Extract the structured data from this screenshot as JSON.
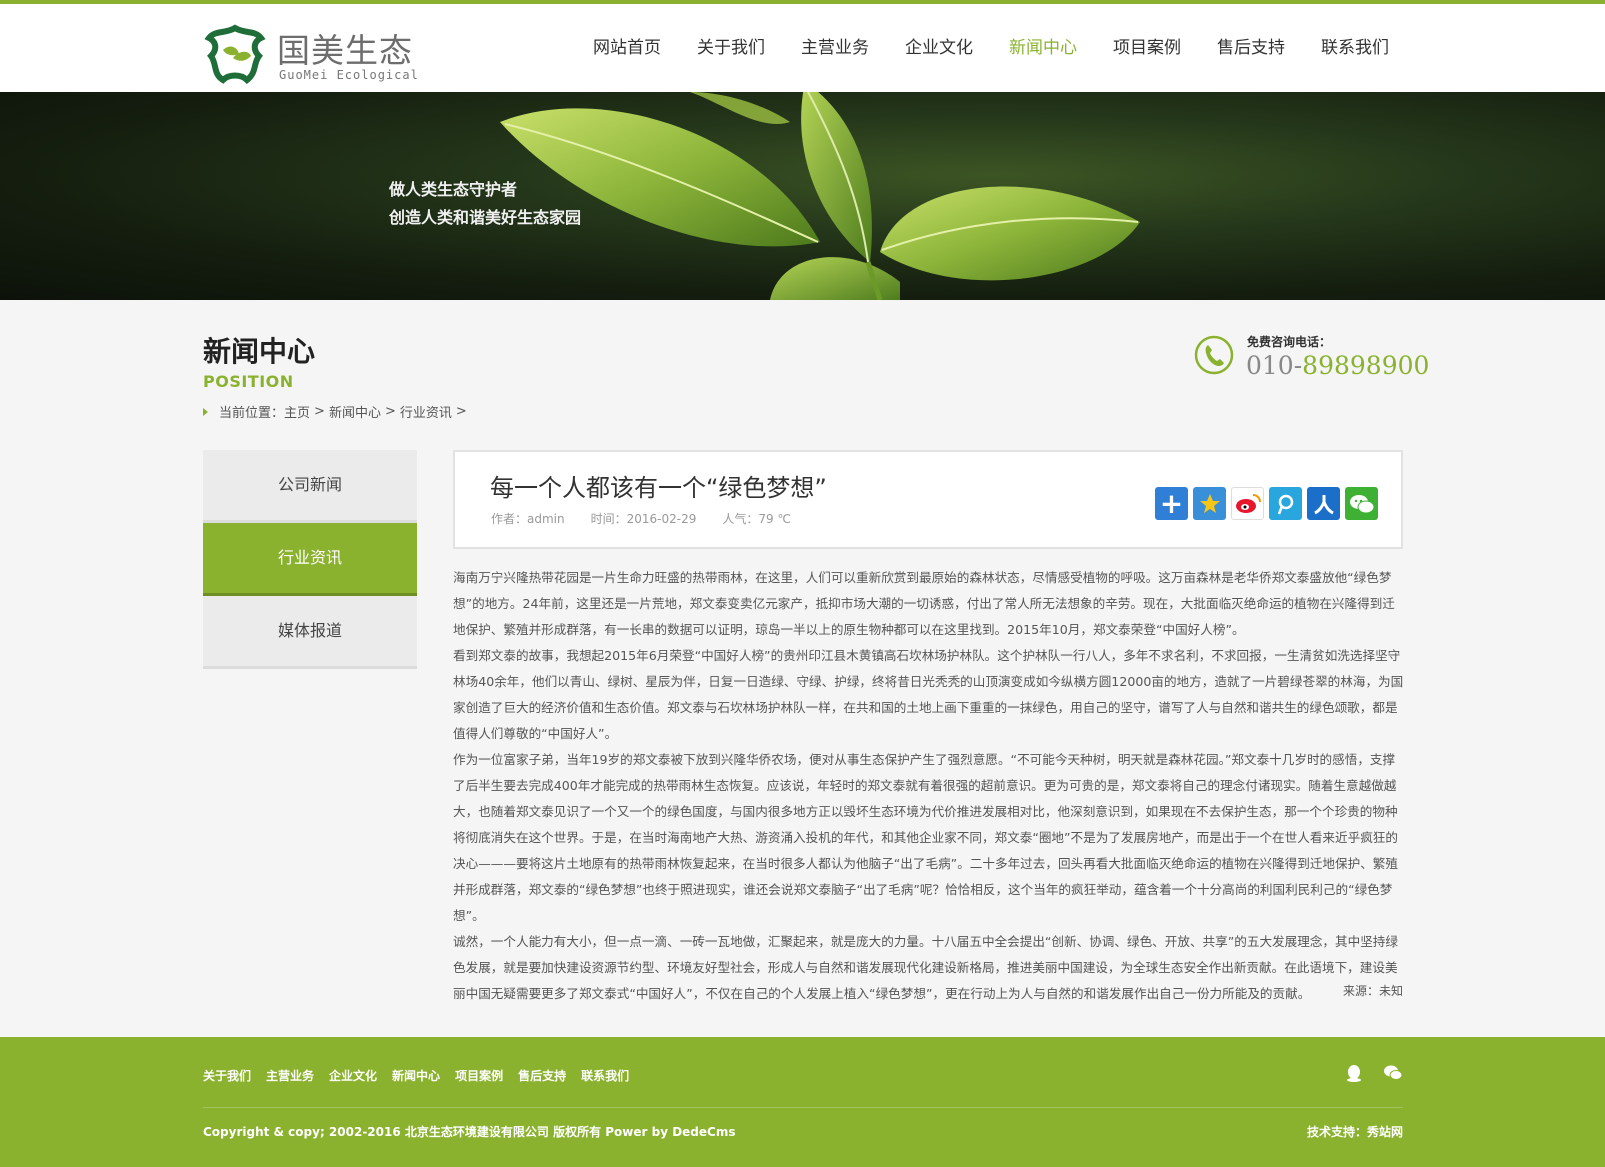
{
  "brand": {
    "name_cn": "国美生态",
    "name_en": "GuoMei  Ecological",
    "accent_color": "#8ab22f"
  },
  "nav": {
    "items": [
      {
        "label": "网站首页"
      },
      {
        "label": "关于我们"
      },
      {
        "label": "主营业务"
      },
      {
        "label": "企业文化"
      },
      {
        "label": "新闻中心"
      },
      {
        "label": "项目案例"
      },
      {
        "label": "售后支持"
      },
      {
        "label": "联系我们"
      }
    ],
    "active": "新闻中心"
  },
  "banner": {
    "line1": "做人类生态守护者",
    "line2": "创造人类和谐美好生态家园"
  },
  "section": {
    "title": "新闻中心",
    "subtitle": "POSITION"
  },
  "breadcrumb": {
    "prefix": "当前位置：",
    "home": "主页",
    "sep1": ">",
    "news": "新闻中心",
    "sep2": ">",
    "category": "行业资讯",
    "sep3": ">"
  },
  "hotline": {
    "label": "免费咨询电话：",
    "prefix": "010-",
    "number": "89898900",
    "icon": "phone-icon"
  },
  "sidebar": {
    "items": [
      {
        "label": "公司新闻"
      },
      {
        "label": "行业资讯"
      },
      {
        "label": "媒体报道"
      }
    ],
    "active": "行业资讯"
  },
  "article": {
    "title": "每一个人都该有一个“绿色梦想”",
    "author": "作者：admin",
    "date": "时间：2016-02-29",
    "views": "人气：79 ℃",
    "share_icons": [
      "share-more-icon",
      "qzone-icon",
      "weibo-icon",
      "tencent-weibo-icon",
      "renren-icon",
      "wechat-icon"
    ],
    "paragraphs": [
      "海南万宁兴隆热带花园是一片生命力旺盛的热带雨林，在这里，人们可以重新欣赏到最原始的森林状态，尽情感受植物的呼吸。这万亩森林是老华侨郑文泰盛放他“绿色梦想”的地方。24年前，这里还是一片荒地，郑文泰变卖亿元家产，抵抑市场大潮的一切诱惑，付出了常人所无法想象的辛劳。现在，大批面临灭绝命运的植物在兴隆得到迁地保护、繁殖并形成群落，有一长串的数据可以证明，琼岛一半以上的原生物种都可以在这里找到。2015年10月，郑文泰荣登“中国好人榜”。",
      "看到郑文泰的故事，我想起2015年6月荣登“中国好人榜”的贵州印江县木黄镇高石坎林场护林队。这个护林队一行八人，多年不求名利，不求回报，一生清贫如洗选择坚守林场40余年，他们以青山、绿树、星辰为伴，日复一日造绿、守绿、护绿，终将昔日光秃秃的山顶演变成如今纵横方圆12000亩的地方，造就了一片碧绿苍翠的林海，为国家创造了巨大的经济价值和生态价值。郑文泰与石坎林场护林队一样，在共和国的土地上画下重重的一抹绿色，用自己的坚守，谱写了人与自然和谐共生的绿色颂歌，都是值得人们尊敬的“中国好人”。",
      "作为一位富家子弟，当年19岁的郑文泰被下放到兴隆华侨农场，便对从事生态保护产生了强烈意愿。“不可能今天种树，明天就是森林花园。”郑文泰十几岁时的感悟，支撑了后半生要去完成400年才能完成的热带雨林生态恢复。应该说，年轻时的郑文泰就有着很强的超前意识。更为可贵的是，郑文泰将自己的理念付诸现实。随着生意越做越大，也随着郑文泰见识了一个又一个的绿色国度，与国内很多地方正以毁坏生态环境为代价推进发展相对比，他深刻意识到，如果现在不去保护生态，那一个个珍贵的物种将彻底消失在这个世界。于是，在当时海南地产大热、游资涌入投机的年代，和其他企业家不同，郑文泰“圈地”不是为了发展房地产，而是出于一个在世人看来近乎疯狂的决心———要将这片土地原有的热带雨林恢复起来，在当时很多人都认为他脑子“出了毛病”。二十多年过去，回头再看大批面临灭绝命运的植物在兴隆得到迁地保护、繁殖并形成群落，郑文泰的“绿色梦想”也终于照进现实，谁还会说郑文泰脑子“出了毛病”呢？恰恰相反，这个当年的疯狂举动，蕴含着一个十分高尚的利国利民利己的“绿色梦想”。",
      "诚然，一个人能力有大小，但一点一滴、一砖一瓦地做，汇聚起来，就是庞大的力量。十八届五中全会提出“创新、协调、绿色、开放、共享”的五大发展理念，其中坚持绿色发展，就是要加快建设资源节约型、环境友好型社会，形成人与自然和谐发展现代化建设新格局，推进美丽中国建设，为全球生态安全作出新贡献。在此语境下，建设美丽中国无疑需要更多了郑文泰式“中国好人”，不仅在自己的个人发展上植入“绿色梦想”，更在行动上为人与自然的和谐发展作出自己一份力所能及的贡献。"
    ],
    "source": "来源：未知"
  },
  "footer": {
    "links": [
      {
        "label": "关于我们"
      },
      {
        "label": "主营业务"
      },
      {
        "label": "企业文化"
      },
      {
        "label": "新闻中心"
      },
      {
        "label": "项目案例"
      },
      {
        "label": "售后支持"
      },
      {
        "label": "联系我们"
      }
    ],
    "icons": [
      "qq-icon",
      "wechat-icon"
    ],
    "copyright": "Copyright & copy; 2002-2016 北京生态环境建设有限公司 版权所有 Power by DedeCms",
    "tech_support": "技术支持：秀站网"
  }
}
